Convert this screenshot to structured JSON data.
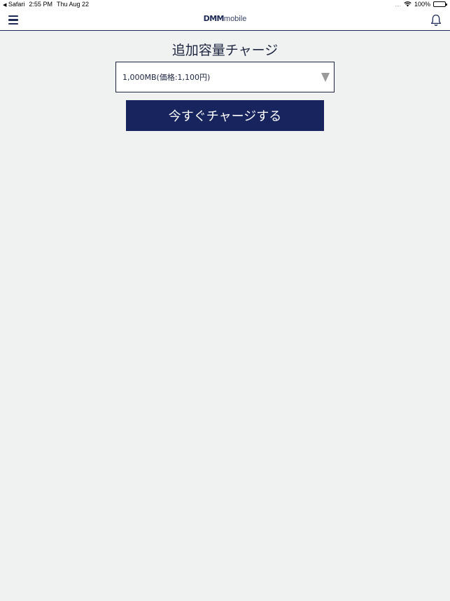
{
  "status_bar": {
    "back_app": "Safari",
    "time": "2:55 PM",
    "date": "Thu Aug 22",
    "battery": "100%"
  },
  "nav_bar": {
    "logo_brand": "DMM",
    "logo_suffix": "mobile",
    "icons": {
      "menu": "hamburger-menu-icon",
      "notifications": "bell-icon"
    }
  },
  "main": {
    "title": "追加容量チャージ",
    "plan_select": {
      "selected_value": "1,000MB(価格:1,100円)"
    },
    "charge_button_label": "今すぐチャージする"
  },
  "colors": {
    "brand_navy": "#17245e",
    "background": "#f0f2f1",
    "text": "#1c2440",
    "arrow_gray": "#9a9a9a"
  }
}
